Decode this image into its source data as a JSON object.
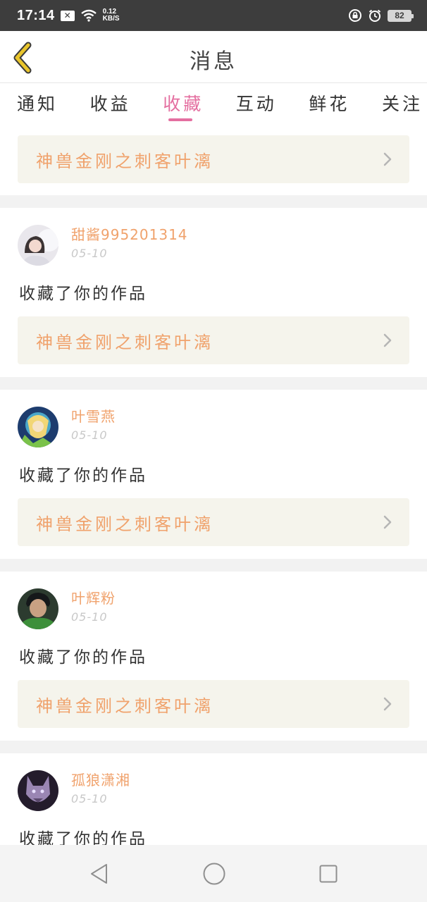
{
  "status_bar": {
    "time": "17:14",
    "net_speed_value": "0.12",
    "net_speed_unit": "KB/S",
    "battery": "82",
    "icons": [
      "close-box-icon",
      "wifi-icon",
      "lock-rotation-icon",
      "alarm-icon",
      "battery-icon"
    ]
  },
  "header": {
    "title": "消息",
    "back_icon": "chevron-left-icon"
  },
  "tabs": [
    {
      "label": "通知",
      "active": false
    },
    {
      "label": "收益",
      "active": false
    },
    {
      "label": "收藏",
      "active": true
    },
    {
      "label": "互动",
      "active": false
    },
    {
      "label": "鲜花",
      "active": false
    },
    {
      "label": "关注",
      "active": false
    }
  ],
  "top_work": {
    "title": "神兽金刚之刺客叶漓"
  },
  "items": [
    {
      "username": "甜酱995201314",
      "date": "05-10",
      "action": "收藏了你的作品",
      "work_title": "神兽金刚之刺客叶漓"
    },
    {
      "username": "叶雪燕",
      "date": "05-10",
      "action": "收藏了你的作品",
      "work_title": "神兽金刚之刺客叶漓"
    },
    {
      "username": "叶辉粉",
      "date": "05-10",
      "action": "收藏了你的作品",
      "work_title": "神兽金刚之刺客叶漓"
    },
    {
      "username": "孤狼潇湘",
      "date": "05-10",
      "action": "收藏了你的作品"
    }
  ],
  "colors": {
    "accent": "#e46fa0",
    "work_title": "#f0a26c",
    "work_bg": "#f5f4ec",
    "back_icon": "#e9c52c"
  },
  "nav_bar": {
    "icons": [
      "back-triangle-icon",
      "home-circle-icon",
      "recents-square-icon"
    ]
  }
}
